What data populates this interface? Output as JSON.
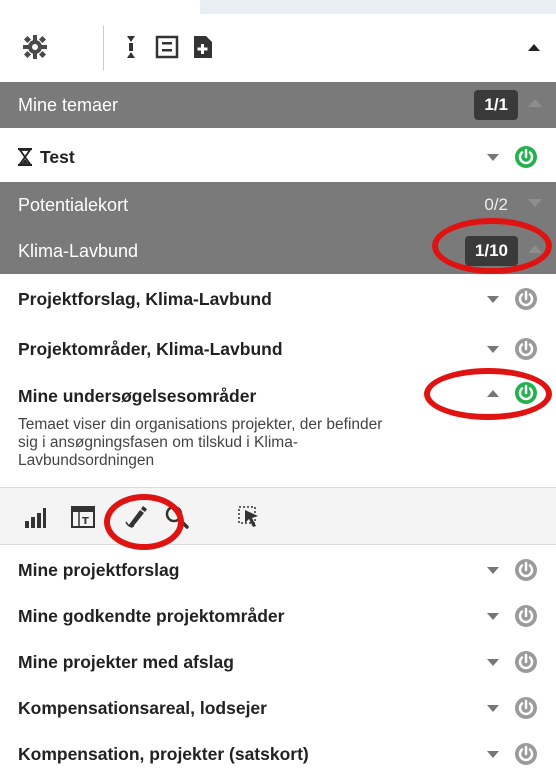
{
  "toolbar": {
    "icons": [
      "gear-icon",
      "expand-collapse-icon",
      "fit-selection-icon",
      "add-document-icon"
    ],
    "collapse_caret": "caret-up-icon"
  },
  "groups": {
    "mine_temaer": {
      "label": "Mine temaer",
      "count": "1/1"
    },
    "potentialekort": {
      "label": "Potentialekort",
      "count": "0/2"
    },
    "klima_lavbund": {
      "label": "Klima-Lavbund",
      "count": "1/10"
    }
  },
  "test_row": {
    "label": "Test",
    "icon": "hourglass-icon",
    "active": true
  },
  "layers": [
    {
      "label": "Projektforslag, Klima-Lavbund",
      "active": false
    },
    {
      "label": "Projektområder, Klima-Lavbund",
      "active": false
    }
  ],
  "expanded_layer": {
    "label": "Mine undersøgelsesområder",
    "active": true,
    "description": "Temaet viser din organisations projekter, der befinder sig i ansøgningsfasen om tilskud i Klima-Lavbundsordningen",
    "tools": [
      "chart-icon",
      "table-icon",
      "edit-pencil-icon",
      "zoom-icon",
      "select-area-icon"
    ]
  },
  "more_layers": [
    {
      "label": "Mine projektforslag",
      "active": false
    },
    {
      "label": "Mine godkendte projektområder",
      "active": false
    },
    {
      "label": "Mine projekter med afslag",
      "active": false
    },
    {
      "label": "Kompensationsareal, lodsejer",
      "active": false
    },
    {
      "label": "Kompensation, projekter (satskort)",
      "active": false
    }
  ],
  "colors": {
    "group_bg": "#7a7a7a",
    "active_green": "#22b14c",
    "inactive_gray": "#9a9a9a",
    "highlight_red": "#e01313"
  }
}
